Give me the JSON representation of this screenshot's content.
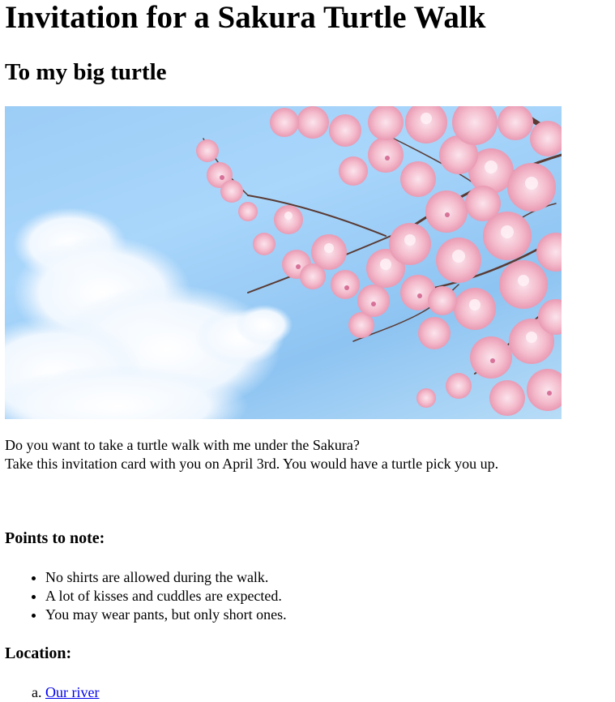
{
  "page": {
    "title": "Invitation for a Sakura Turtle Walk",
    "subtitle": "To my big turtle"
  },
  "hero_image": {
    "alt": "Cherry blossoms against a blue sky",
    "colors": {
      "sky": "#9ccdf6",
      "cloud": "#ffffff",
      "blossom": "#f5c3d2",
      "branch": "#5a3a33"
    }
  },
  "intro": {
    "line1": "Do you want to take a turtle walk with me under the Sakura?",
    "line2": "Take this invitation card with you on April 3rd. You would have a turtle pick you up."
  },
  "points": {
    "heading": "Points to note:",
    "items": [
      "No shirts are allowed during the walk.",
      "A lot of kisses and cuddles are expected.",
      "You may wear pants, but only short ones."
    ]
  },
  "location": {
    "heading": "Location:",
    "items": [
      {
        "label": "Our river"
      }
    ]
  },
  "link_color": "#0000ee"
}
